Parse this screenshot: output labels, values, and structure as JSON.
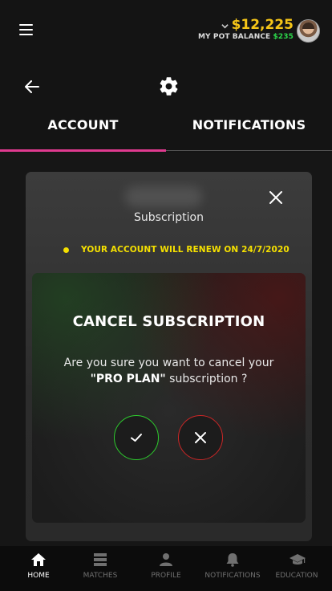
{
  "header": {
    "balance_amount": "$12,225",
    "pot_label": "MY POT BALANCE",
    "pot_value": "$235"
  },
  "tabs": [
    {
      "label": "ACCOUNT",
      "active": true
    },
    {
      "label": "NOTIFICATIONS",
      "active": false
    }
  ],
  "card": {
    "title": "Subscription",
    "renew_notice": "YOUR ACCOUNT WILL RENEW ON 24/7/2020"
  },
  "modal": {
    "title": "CANCEL SUBSCRIPTION",
    "message_prefix": "Are you sure you want to cancel your ",
    "plan_name": "\"PRO PLAN\"",
    "message_suffix": " subscription ?"
  },
  "bottom_nav": [
    {
      "label": "HOME",
      "icon": "home-icon",
      "active": true
    },
    {
      "label": "MATCHES",
      "icon": "matches-icon",
      "active": false
    },
    {
      "label": "PROFILE",
      "icon": "profile-icon",
      "active": false
    },
    {
      "label": "NOTIFICATIONS",
      "icon": "bell-icon",
      "active": false
    },
    {
      "label": "EDUCATION",
      "icon": "graduation-cap-icon",
      "active": false
    }
  ],
  "colors": {
    "accent_pink": "#e03a8f",
    "balance_gold": "#f5c518",
    "pot_green": "#2bd64a",
    "notice_yellow": "#f5e000",
    "confirm_green": "#2dcc2d",
    "cancel_red": "#cc2626"
  }
}
